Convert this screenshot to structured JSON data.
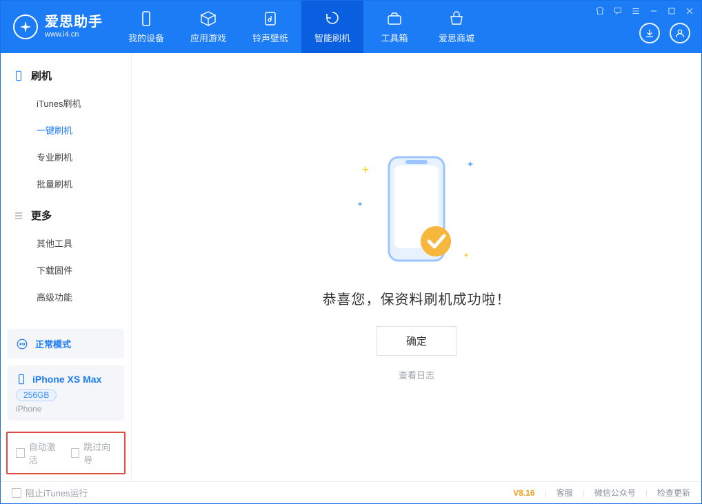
{
  "app": {
    "title": "爱思助手",
    "subtitle": "www.i4.cn"
  },
  "tabs": [
    {
      "label": "我的设备"
    },
    {
      "label": "应用游戏"
    },
    {
      "label": "铃声壁纸"
    },
    {
      "label": "智能刷机"
    },
    {
      "label": "工具箱"
    },
    {
      "label": "爱思商城"
    }
  ],
  "sidebar": {
    "section1": {
      "title": "刷机",
      "items": [
        "iTunes刷机",
        "一键刷机",
        "专业刷机",
        "批量刷机"
      ]
    },
    "section2": {
      "title": "更多",
      "items": [
        "其他工具",
        "下载固件",
        "高级功能"
      ]
    }
  },
  "mode": {
    "label": "正常模式"
  },
  "device": {
    "name": "iPhone XS Max",
    "capacity": "256GB",
    "type": "iPhone"
  },
  "options": {
    "autoActivate": "自动激活",
    "skipGuide": "跳过向导"
  },
  "main": {
    "successTitle": "恭喜您，保资料刷机成功啦！",
    "okButton": "确定",
    "viewLog": "查看日志"
  },
  "footer": {
    "blockItunes": "阻止iTunes运行",
    "version": "V8.16",
    "links": [
      "客服",
      "微信公众号",
      "检查更新"
    ]
  }
}
